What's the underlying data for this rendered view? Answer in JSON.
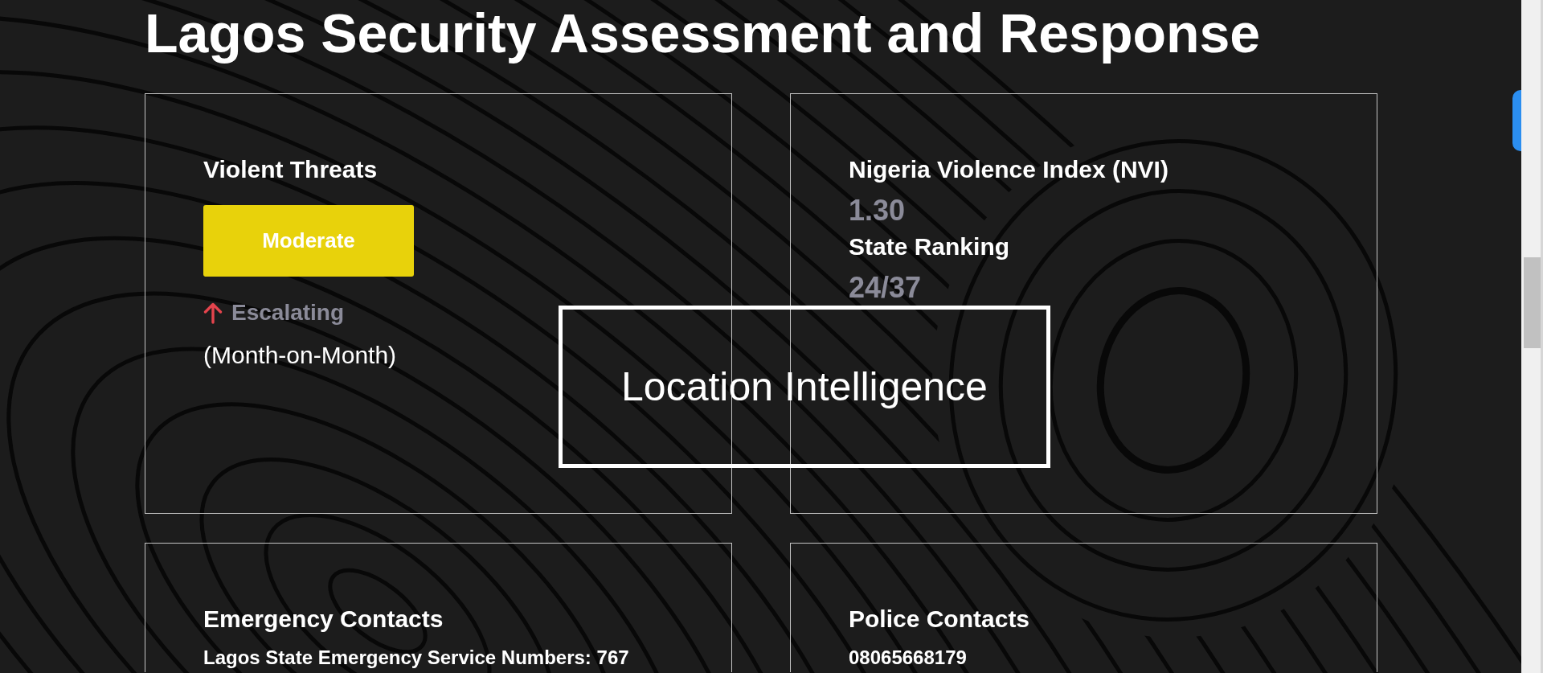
{
  "title": "Lagos Security Assessment and Response",
  "cards": [
    {
      "kind": "threat",
      "heading": "Violent Threats",
      "rating": "Moderate",
      "trend": {
        "rising": true,
        "label": "Escalating"
      },
      "period": "(Month-on-Month)"
    },
    {
      "kind": "metrics",
      "metrics": [
        {
          "label": "Nigeria Violence Index (NVI)",
          "value": "1.30"
        },
        {
          "label": "State Ranking",
          "value": "24/37"
        }
      ]
    },
    {
      "kind": "contacts",
      "heading": "Emergency Contacts",
      "lines": [
        "Lagos State Emergency Service Numbers: 767"
      ]
    },
    {
      "kind": "contacts",
      "heading": "Police Contacts",
      "lines": [
        "08065668179"
      ]
    }
  ],
  "overlay": {
    "label": "Location Intelligence"
  }
}
